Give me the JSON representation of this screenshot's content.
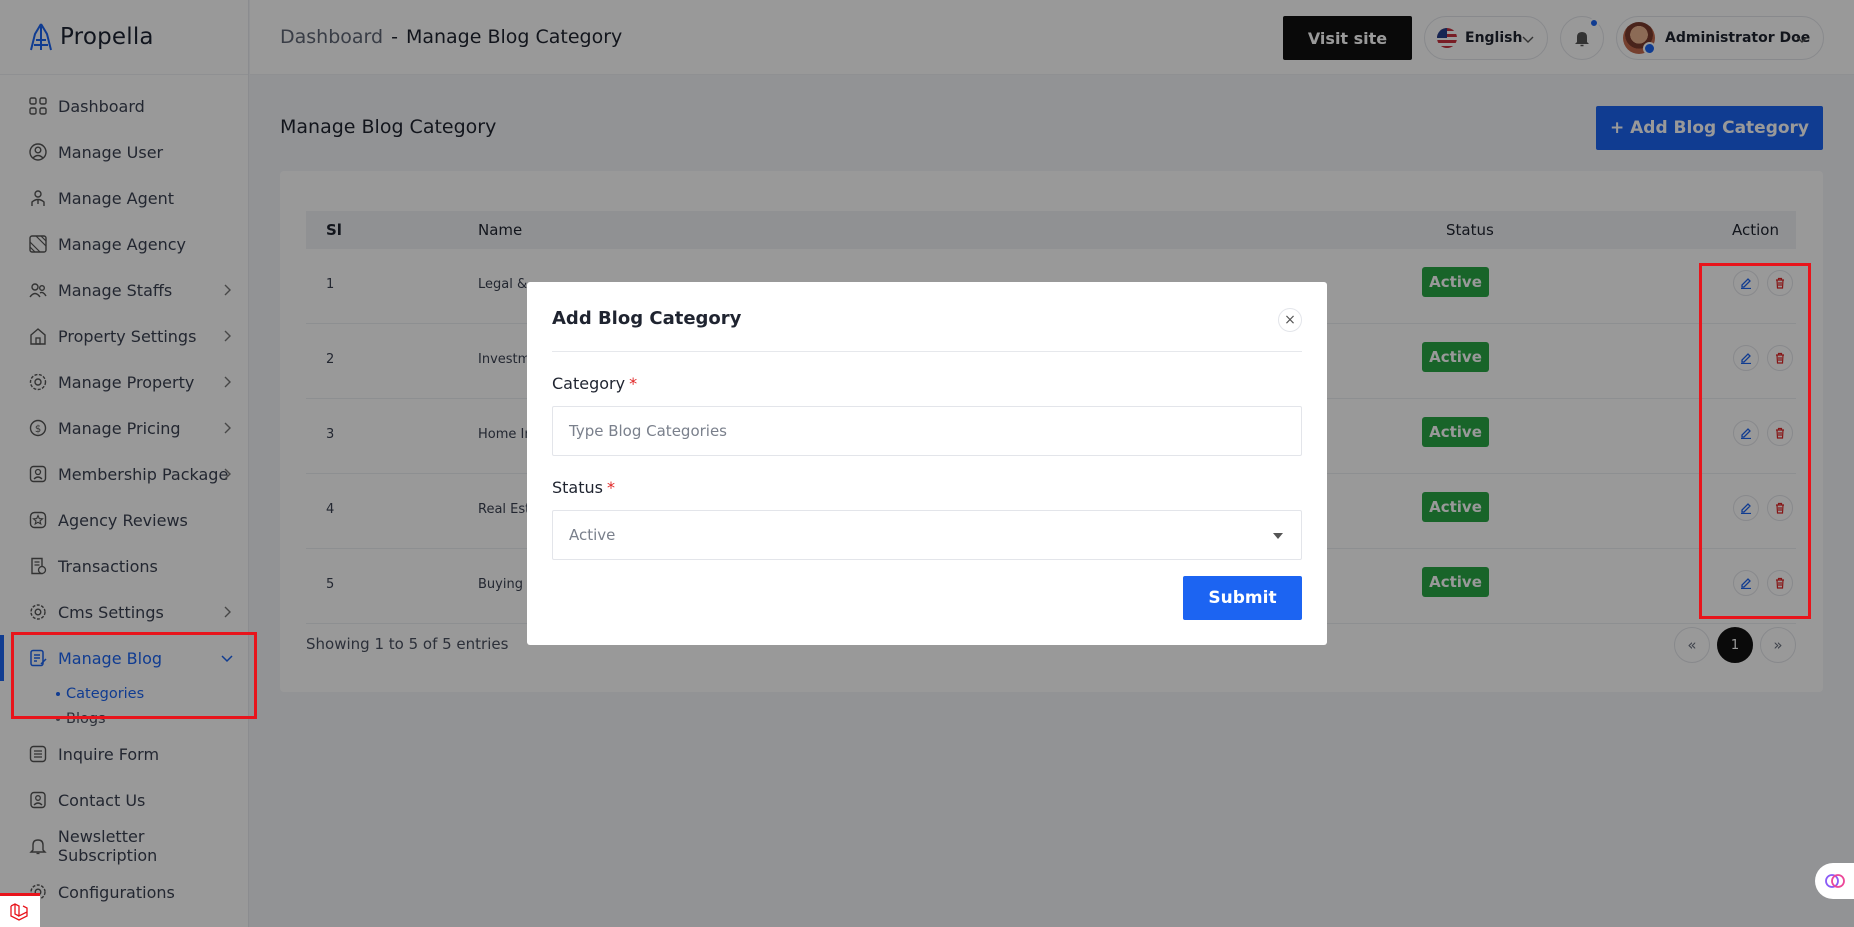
{
  "brand": {
    "name": "Propella"
  },
  "header": {
    "breadcrumb_home": "Dashboard",
    "breadcrumb_sep": "-",
    "breadcrumb_current": "Manage Blog Category",
    "visit_site": "Visit site",
    "language": "English",
    "user_name": "Administrator Doe"
  },
  "sidebar": {
    "items": [
      {
        "label": "Dashboard",
        "icon": "grid-icon"
      },
      {
        "label": "Manage User",
        "icon": "user-icon"
      },
      {
        "label": "Manage Agent",
        "icon": "agent-icon"
      },
      {
        "label": "Manage Agency",
        "icon": "agency-icon"
      },
      {
        "label": "Manage Staffs",
        "icon": "users-icon",
        "has_children": true
      },
      {
        "label": "Property Settings",
        "icon": "home-settings-icon",
        "has_children": true
      },
      {
        "label": "Manage Property",
        "icon": "gear-icon",
        "has_children": true
      },
      {
        "label": "Manage Pricing",
        "icon": "dollar-icon",
        "has_children": true
      },
      {
        "label": "Membership Package",
        "icon": "id-card-icon",
        "has_children": true
      },
      {
        "label": "Agency Reviews",
        "icon": "star-icon"
      },
      {
        "label": "Transactions",
        "icon": "receipt-icon"
      },
      {
        "label": "Cms Settings",
        "icon": "gear-icon",
        "has_children": true
      },
      {
        "label": "Manage Blog",
        "icon": "blog-icon",
        "has_children": true,
        "active": true
      },
      {
        "label": "Inquire Form",
        "icon": "list-icon"
      },
      {
        "label": "Contact Us",
        "icon": "contact-icon"
      },
      {
        "label": "Newsletter Subscription",
        "icon": "bell-icon"
      },
      {
        "label": "Configurations",
        "icon": "gear-icon"
      }
    ],
    "blog_submenu": [
      {
        "label": "Categories",
        "active": true
      },
      {
        "label": "Blogs",
        "active": false
      }
    ]
  },
  "main": {
    "title": "Manage Blog Category",
    "add_button": "+ Add Blog Category",
    "table": {
      "headers": {
        "sl": "Sl",
        "name": "Name",
        "status": "Status",
        "action": "Action"
      },
      "rows": [
        {
          "sl": "1",
          "name": "Legal &",
          "status": "Active"
        },
        {
          "sl": "2",
          "name": "Investm",
          "status": "Active"
        },
        {
          "sl": "3",
          "name": "Home In",
          "status": "Active"
        },
        {
          "sl": "4",
          "name": "Real Este",
          "status": "Active"
        },
        {
          "sl": "5",
          "name": "Buying &",
          "status": "Active"
        }
      ]
    },
    "showing": "Showing 1 to 5 of 5 entries",
    "pagination": {
      "prev": "«",
      "current": "1",
      "next": "»"
    }
  },
  "modal": {
    "title": "Add Blog Category",
    "close": "×",
    "category_label": "Category",
    "category_placeholder": "Type Blog Categories",
    "status_label": "Status",
    "status_value": "Active",
    "required_mark": "*",
    "submit": "Submit"
  },
  "colors": {
    "primary": "#1c64f2",
    "success": "#28a745",
    "danger": "#e02424",
    "highlight": "#e8141b"
  }
}
